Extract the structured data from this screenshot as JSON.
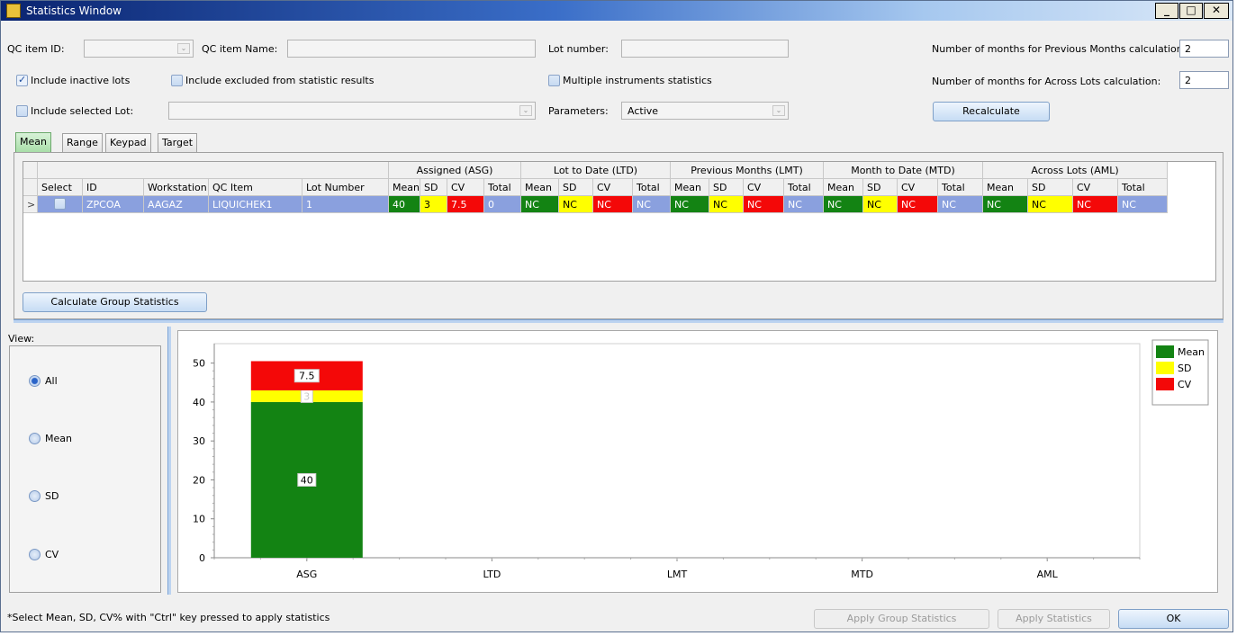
{
  "window": {
    "title": "Statistics Window",
    "minimize": "_",
    "maximize": "□",
    "close": "✕"
  },
  "filters": {
    "qc_item_id_label": "QC item ID:",
    "qc_item_id_value": "",
    "qc_item_name_label": "QC item Name:",
    "qc_item_name_value": "",
    "lot_number_label": "Lot number:",
    "lot_number_value": "",
    "prev_months_label": "Number of months for Previous Months calculation:",
    "prev_months_value": "2",
    "across_lots_label": "Number of months for Across Lots calculation:",
    "across_lots_value": "2",
    "include_inactive_label": "Include inactive lots",
    "include_inactive_checked": true,
    "include_excluded_label": "Include excluded from statistic results",
    "include_excluded_checked": false,
    "multiple_instruments_label": "Multiple instruments statistics",
    "multiple_instruments_checked": false,
    "include_selected_lot_label": "Include selected Lot:",
    "include_selected_lot_checked": false,
    "selected_lot_value": "",
    "parameters_label": "Parameters:",
    "parameters_value": "Active",
    "recalculate_label": "Recalculate"
  },
  "tabs": [
    {
      "label": "Mean",
      "active": true
    },
    {
      "label": "Range",
      "active": false
    },
    {
      "label": "Keypad",
      "active": false
    },
    {
      "label": "Target",
      "active": false
    }
  ],
  "grid": {
    "groups": [
      "Assigned (ASG)",
      "Lot to Date (LTD)",
      "Previous Months (LMT)",
      "Month to Date (MTD)",
      "Across Lots (AML)"
    ],
    "base_columns": [
      "Select",
      "ID",
      "Workstation",
      "QC Item",
      "Lot Number"
    ],
    "stat_columns": [
      "Mean",
      "SD",
      "CV",
      "Total"
    ],
    "rows": [
      {
        "selected": false,
        "id": "ZPCOA",
        "workstation": "AAGAZ",
        "qc_item": "LIQUICHEK1",
        "lot_number": "1",
        "asg": [
          "40",
          "3",
          "7.5",
          "0"
        ],
        "ltd": [
          "NC",
          "NC",
          "NC",
          "NC"
        ],
        "lmt": [
          "NC",
          "NC",
          "NC",
          "NC"
        ],
        "mtd": [
          "NC",
          "NC",
          "NC",
          "NC"
        ],
        "aml": [
          "NC",
          "NC",
          "NC",
          "NC"
        ]
      }
    ]
  },
  "calc_group_label": "Calculate Group Statistics",
  "view": {
    "title": "View:",
    "options": [
      {
        "label": "All",
        "selected": true
      },
      {
        "label": "Mean",
        "selected": false
      },
      {
        "label": "SD",
        "selected": false
      },
      {
        "label": "CV",
        "selected": false
      }
    ]
  },
  "chart_data": {
    "type": "bar",
    "stacked": true,
    "categories": [
      "ASG",
      "LTD",
      "LMT",
      "MTD",
      "AML"
    ],
    "series": [
      {
        "name": "Mean",
        "color": "#138313",
        "values": [
          40,
          0,
          0,
          0,
          0
        ],
        "labels": [
          "40",
          "",
          "",
          "",
          ""
        ]
      },
      {
        "name": "SD",
        "color": "#ffff00",
        "values": [
          3,
          0,
          0,
          0,
          0
        ],
        "labels": [
          "3",
          "",
          "",
          "",
          ""
        ]
      },
      {
        "name": "CV",
        "color": "#f40808",
        "values": [
          7.5,
          0,
          0,
          0,
          0
        ],
        "labels": [
          "7.5",
          "",
          "",
          "",
          ""
        ]
      }
    ],
    "yticks": [
      "0",
      "10",
      "20",
      "30",
      "40",
      "50"
    ],
    "ylim": [
      0,
      55
    ],
    "legend_position": "top-right"
  },
  "footer": {
    "hint": "*Select Mean, SD, CV% with \"Ctrl\" key pressed to apply statistics",
    "apply_group_label": "Apply Group Statistics",
    "apply_stats_label": "Apply Statistics",
    "ok_label": "OK"
  }
}
